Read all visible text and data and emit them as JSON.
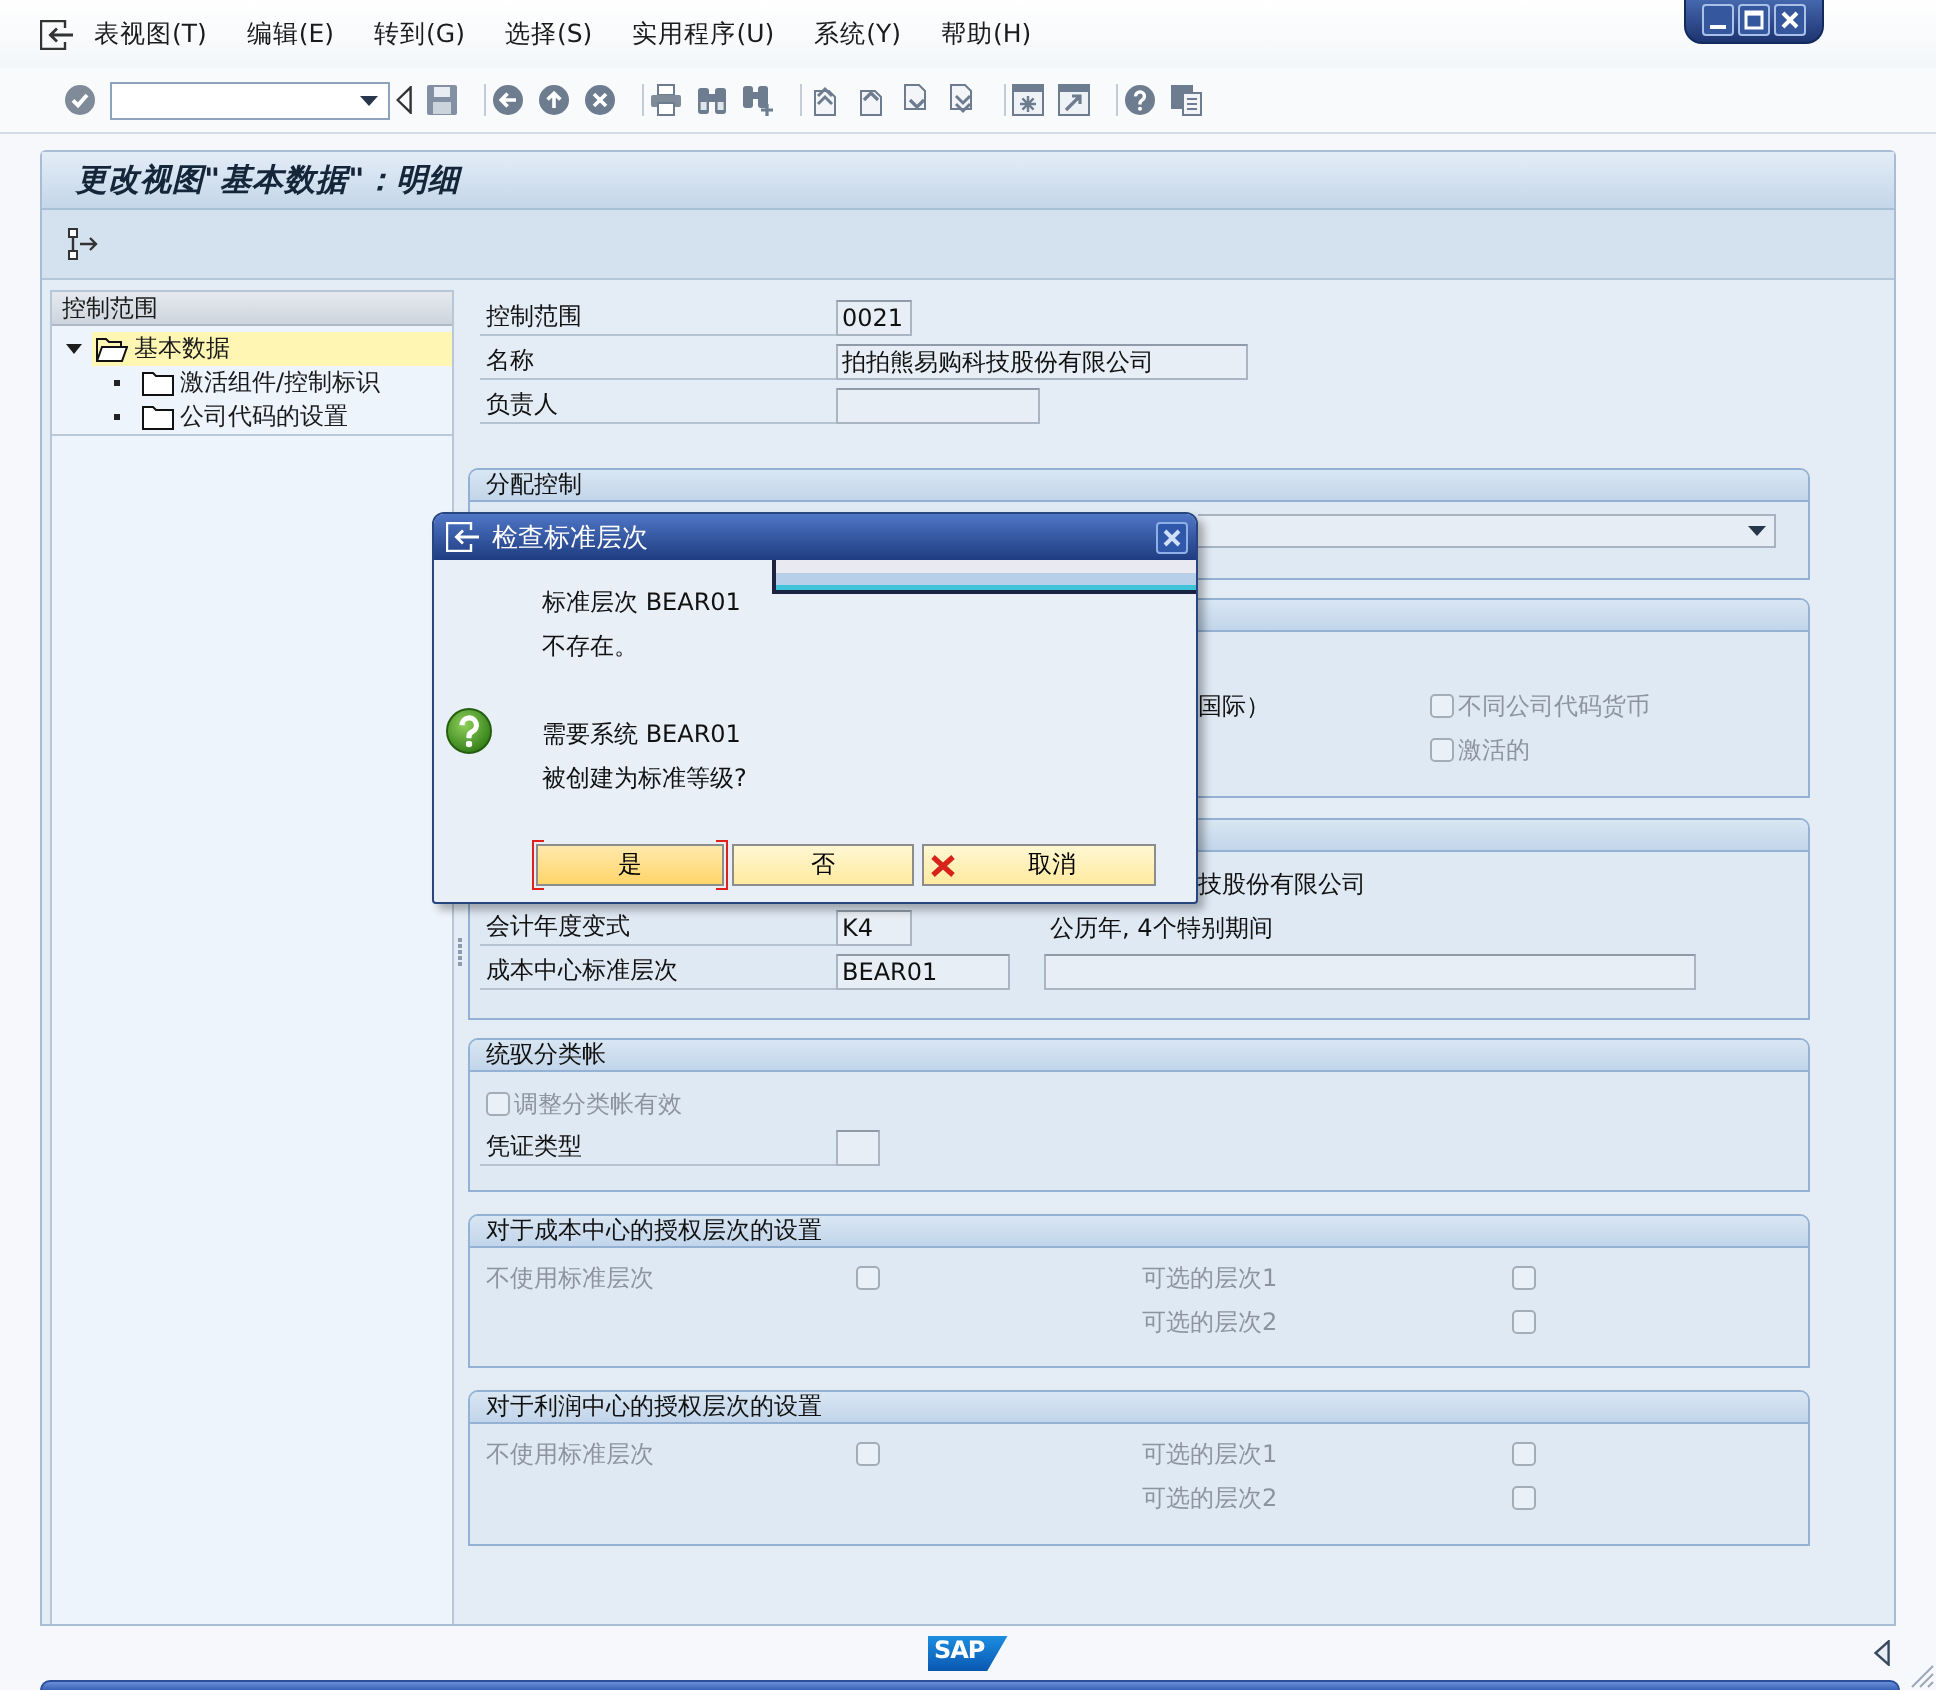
{
  "menu_bar": {
    "items": [
      "表视图(T)",
      "编辑(E)",
      "转到(G)",
      "选择(S)",
      "实用程序(U)",
      "系统(Y)",
      "帮助(H)"
    ]
  },
  "title": "更改视图\"基本数据\"：明细",
  "tree": {
    "header": "控制范围",
    "items": [
      {
        "label": "基本数据",
        "expanded": true,
        "selected": true,
        "children": [
          {
            "label": "激活组件/控制标识",
            "selected": false
          },
          {
            "label": "公司代码的设置",
            "selected": false
          }
        ]
      }
    ]
  },
  "header_fields": [
    {
      "label": "控制范围",
      "value": "0021"
    },
    {
      "label": "名称",
      "value": "拍拍熊易购科技股份有限公司"
    },
    {
      "label": "负责人"
    }
  ],
  "sections": [
    {
      "title": "分配控制",
      "rows": [
        {
          "kind": "dropdown"
        }
      ]
    },
    {
      "rows": [
        {
          "kind": "checkbox_row",
          "text": "国际）",
          "checkbox": {
            "label": "不同公司代码货币",
            "checked": false,
            "disabled": true
          }
        },
        {
          "kind": "checkbox_row",
          "checkbox": {
            "label": "激活的",
            "checked": false,
            "disabled": true
          }
        }
      ]
    },
    {
      "rows": [
        {
          "kind": "text_row",
          "text": "技股份有限公司"
        },
        {
          "kind": "field_row",
          "label": "会计年度变式",
          "value": "K4",
          "description": "公历年, 4个特别期间"
        },
        {
          "kind": "field_row",
          "label": "成本中心标准层次",
          "value": "BEAR01",
          "description_box": true
        }
      ]
    },
    {
      "title": "统驭分类帐",
      "rows": [
        {
          "kind": "checkbox",
          "label": "调整分类帐有效",
          "checked": false,
          "disabled": true
        },
        {
          "kind": "field_row",
          "label": "凭证类型"
        }
      ]
    },
    {
      "title": "对于成本中心的授权层次的设置",
      "rows": [
        {
          "kind": "check_pair",
          "left": {
            "label": "不使用标准层次",
            "checked": false,
            "disabled": true
          },
          "right": {
            "label": "可选的层次1",
            "checked": false,
            "disabled": true
          }
        },
        {
          "kind": "check_pair",
          "right": {
            "label": "可选的层次2",
            "checked": false,
            "disabled": true
          }
        }
      ]
    },
    {
      "title": "对于利润中心的授权层次的设置",
      "rows": [
        {
          "kind": "check_pair",
          "left": {
            "label": "不使用标准层次",
            "checked": false,
            "disabled": true
          },
          "right": {
            "label": "可选的层次1",
            "checked": false,
            "disabled": true
          }
        },
        {
          "kind": "check_pair",
          "right": {
            "label": "可选的层次2",
            "checked": false,
            "disabled": true
          }
        }
      ]
    }
  ],
  "dialog": {
    "title": "检查标准层次",
    "paragraphs": [
      [
        "标准层次 BEAR01",
        "不存在。"
      ],
      [
        "需要系统 BEAR01",
        "被创建为标准等级?"
      ]
    ],
    "buttons": [
      {
        "label": "是",
        "kind": "plain",
        "focused": true
      },
      {
        "label": "否",
        "kind": "plain",
        "focused": false
      },
      {
        "label": "取消",
        "kind": "cancel",
        "focused": false
      }
    ]
  },
  "footer": {
    "logo": "SAP"
  }
}
